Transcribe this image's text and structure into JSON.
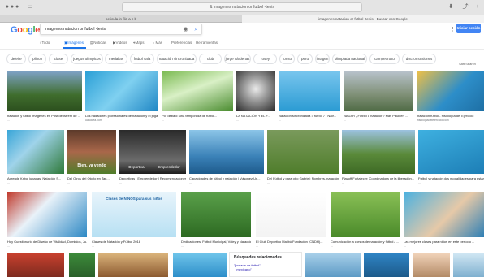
{
  "browser": {
    "address": "& imagenes natacion or futbol -tenis",
    "tabs": [
      "pelicula in fila a c b",
      "imagenes natacion or futbol -tenis - Buscar con Google"
    ]
  },
  "google": {
    "logo": "Google",
    "query": "imagenes natacion or futbol -tenis",
    "signin_label": "Iniciar sesión",
    "safesearch_label": "SafeSearch"
  },
  "tools": {
    "items": [
      "Todo",
      "Imágenes",
      "Noticias",
      "Vídeos",
      "Maps",
      "Más",
      "Preferencias",
      "Herramientas"
    ],
    "active_index": 1
  },
  "chips": [
    "deleite",
    "plinco",
    "clase",
    "juegos olímpicos",
    "medallas",
    "fútbol sala",
    "natación sincronizada",
    "club",
    "jorge cárdenas",
    "rosey",
    "tonso",
    "peru",
    "imagen",
    "olimpiada nacional",
    "campeonato",
    "discromotsiones"
  ],
  "results": [
    {
      "caption": "natación y fútbol imágenes en Post de Istrem de ...",
      "source": "..."
    },
    {
      "caption": "Los nadadores profesionales de natación y el jugador...",
      "source": "uafulcea.com"
    },
    {
      "caption": "Por debajo: una temporada de fútbol...",
      "source": "..."
    },
    {
      "caption": "LA NATACIÓN Y EL F...",
      "source": "..."
    },
    {
      "caption": "Natación sincronizada > fútbol 7 / Natr...",
      "source": "..."
    },
    {
      "caption": "NADAR ¿Fútbol o natación? Más Pauli en ...",
      "source": "..."
    },
    {
      "caption": "natación futbol - Fisiología del Ejercicio",
      "source": "fisiologiadelejercicio.com"
    },
    {
      "caption": "Aprende fútbol jugadas: Natación S...",
      "source": "..."
    },
    {
      "caption": "Del Otros del Otoño en Tan...",
      "source": "..."
    },
    {
      "caption": "Deportivas | Emprendedor | Recomendaciones",
      "source": "..."
    },
    {
      "caption": "Capacidades de fútbol y natación | Vásquez Un...",
      "source": "..."
    },
    {
      "caption": "Del Fútbol y para otro Gabriel: Nombres, natación y li...",
      "source": "..."
    },
    {
      "caption": "Playoff Fortalecer: Coordinadora de la liberación...",
      "source": "..."
    },
    {
      "caption": "Futbol y natación dos modalidades para estar...",
      "source": "..."
    },
    {
      "caption": "Hoy Cuestionario de Diseño de Vitalidad, Dominios, Ju...",
      "source": "..."
    },
    {
      "caption": "Clases de Natación y Fútbol 2018",
      "source": "..."
    },
    {
      "caption": "Dedicaciones, Fútbol Municipal, Vóley y Natación ...",
      "source": "..."
    },
    {
      "caption": "El Club Deportivo Malibú Fundación (CNDH)...",
      "source": "..."
    },
    {
      "caption": "Comunicación a cursos de natación y fútbol / ...",
      "source": "..."
    },
    {
      "caption": "Las mejores clases para niños en este período ...",
      "source": "..."
    }
  ],
  "row2_banner": {
    "caption_a": "Deportiva",
    "caption_b": "Emprendedor",
    "meme_text": "Bien, ya vendo"
  },
  "flyer_text": "Clases de NIÑOS para sus niños",
  "related": {
    "title": "Búsquedas relacionadas",
    "item": "\"jornada de futbol\"\n   mexicano\""
  },
  "colors": {
    "google_blue": "#4285f4",
    "google_red": "#ea4335",
    "google_yellow": "#fbbc05",
    "google_green": "#34a853",
    "link_blue": "#1a73e8"
  }
}
